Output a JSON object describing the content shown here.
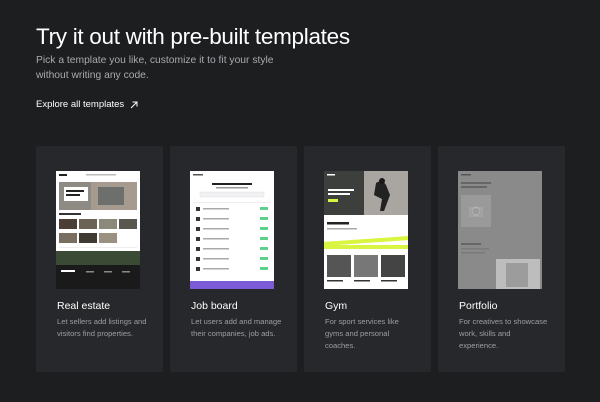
{
  "header": {
    "title": "Try it out with pre-built templates",
    "subtitle": "Pick a template you like, customize it to fit your style without writing any code.",
    "explore_label": "Explore all templates"
  },
  "cards": [
    {
      "title": "Real estate",
      "description": "Let sellers add listings and visitors find properties.",
      "preview_heading": "Find your dream house"
    },
    {
      "title": "Job board",
      "description": "Let users add and manage their companies, job ads.",
      "preview_heading": "Find your dream remote job"
    },
    {
      "title": "Gym",
      "description": "For sport services like gyms and personal coaches.",
      "preview_heading": "Why Gym?",
      "preview_label": "Gym"
    },
    {
      "title": "Portfolio",
      "description": "For creatives to showcase work, skills and experience.",
      "preview_heading": "Selected work"
    }
  ],
  "colors": {
    "background": "#1d1e20",
    "card": "#27282b",
    "jobboard_accent": "#7b5cd6",
    "jobboard_tag": "#5fcf8c",
    "gym_accent": "#d9f441"
  }
}
